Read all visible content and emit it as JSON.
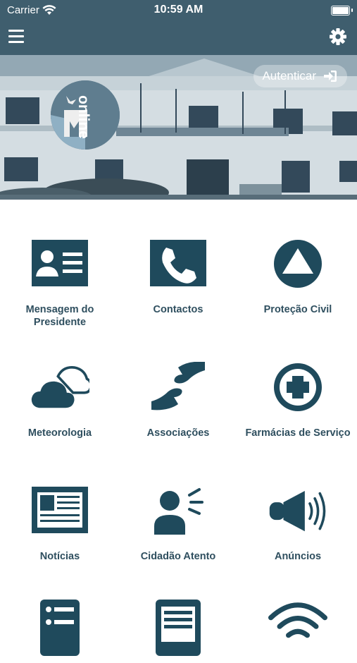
{
  "status_bar": {
    "carrier": "Carrier",
    "time": "10:59 AM"
  },
  "header": {
    "menu_icon": "hamburger-menu-icon",
    "settings_icon": "gear-icon"
  },
  "banner": {
    "logo_text": "online",
    "auth_button_label": "Autenticar",
    "auth_icon": "sign-in-icon"
  },
  "colors": {
    "brand": "#1f4a5c",
    "header": "#3f5e6e",
    "label": "#2f4f5f"
  },
  "grid": {
    "items": [
      {
        "label": "Mensagem do Presidente",
        "icon": "id-card-icon"
      },
      {
        "label": "Contactos",
        "icon": "phone-icon"
      },
      {
        "label": "Proteção Civil",
        "icon": "civil-protection-icon"
      },
      {
        "label": "Meteorologia",
        "icon": "cloud-icon"
      },
      {
        "label": "Associações",
        "icon": "handshake-icon"
      },
      {
        "label": "Farmácias de Serviço",
        "icon": "pharmacy-cross-icon"
      },
      {
        "label": "Notícias",
        "icon": "newspaper-icon"
      },
      {
        "label": "Cidadão Atento",
        "icon": "speaking-person-icon"
      },
      {
        "label": "Anúncios",
        "icon": "megaphone-icon"
      },
      {
        "label": "",
        "icon": "list-icon"
      },
      {
        "label": "",
        "icon": "document-icon"
      },
      {
        "label": "",
        "icon": "wifi-icon"
      }
    ]
  }
}
